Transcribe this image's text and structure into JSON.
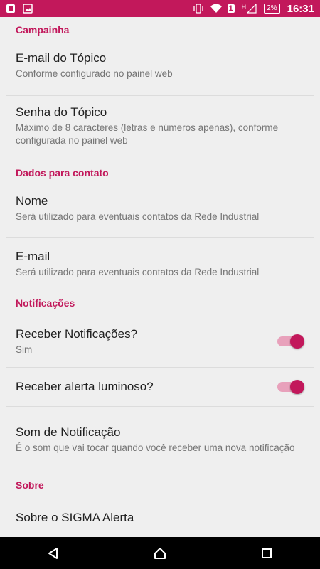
{
  "status": {
    "time": "16:31",
    "battery": "2%",
    "signal_label": "H",
    "sim_label": "1"
  },
  "sections": {
    "campanha": {
      "header": "Campainha",
      "items": [
        {
          "title": "E-mail do Tópico",
          "summary": "Conforme configurado no painel web"
        },
        {
          "title": "Senha do Tópico",
          "summary": "Máximo de 8 caracteres (letras e números apenas), conforme configurada no painel web"
        }
      ]
    },
    "contato": {
      "header": "Dados para contato",
      "items": [
        {
          "title": "Nome",
          "summary": "Será utilizado para eventuais contatos da Rede Industrial"
        },
        {
          "title": "E-mail",
          "summary": "Será utilizado para eventuais contatos da Rede Industrial"
        }
      ]
    },
    "notificacoes": {
      "header": "Notificações",
      "receber": {
        "title": "Receber Notificações?",
        "summary": "Sim",
        "checked": true
      },
      "alerta": {
        "title": "Receber alerta luminoso?",
        "checked": true
      },
      "som": {
        "title": "Som de Notificação",
        "summary": "É o som que vai tocar quando você receber uma nova notificação"
      }
    },
    "sobre": {
      "header": "Sobre",
      "item": {
        "title": "Sobre o SIGMA Alerta"
      }
    }
  },
  "colors": {
    "accent": "#c2185b",
    "switch_track": "#e8a1bb"
  },
  "icons": {
    "status_left": [
      "notification-icon",
      "image-icon"
    ],
    "status_right": [
      "vibrate-icon",
      "wifi-icon",
      "sim-icon",
      "signal-icon",
      "battery-icon"
    ],
    "nav": [
      "back-icon",
      "home-icon",
      "recents-icon"
    ]
  }
}
